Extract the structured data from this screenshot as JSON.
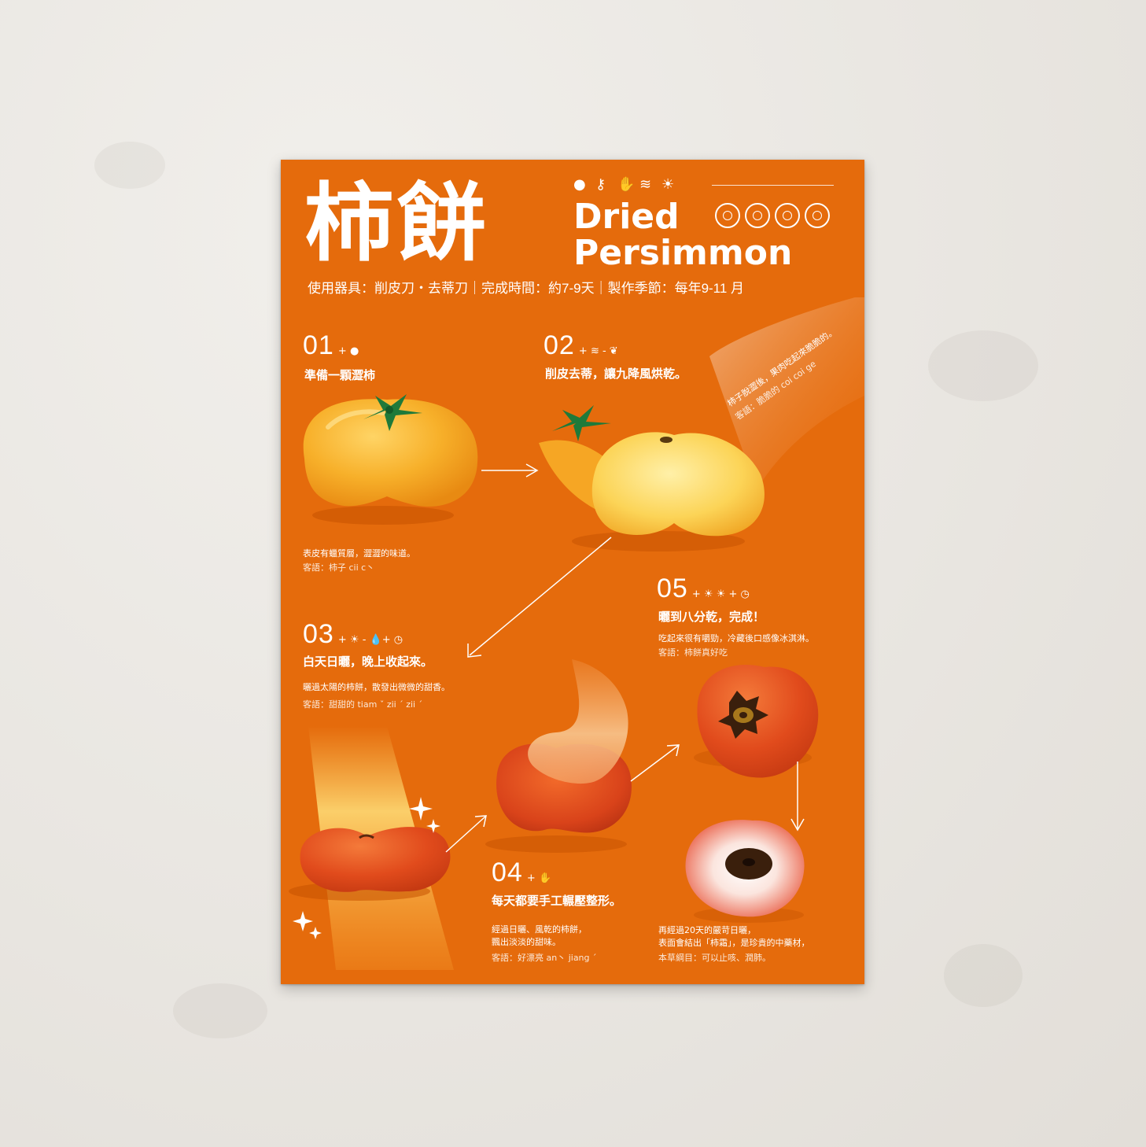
{
  "poster": {
    "title_zh": "柿餅",
    "title_en_line1": "Dried",
    "title_en_line2": "Persimmon",
    "meta": "使用器具：削皮刀・去蒂刀｜完成時間：約7-9天｜製作季節：每年9-11 月",
    "header_icons": [
      "persimmon-icon",
      "knife-icon",
      "hand-icon",
      "wind-icon",
      "sun-icon"
    ]
  },
  "steps": [
    {
      "num": "01",
      "icons": "+ ●",
      "title": "準備一顆澀柿",
      "desc": "表皮有蠟質層，澀澀的味道。",
      "note": "客語：柿子 cii c丶"
    },
    {
      "num": "02",
      "icons": "+ ≋ - ❦",
      "title": "削皮去蒂，讓九降風烘乾。",
      "desc": "柿子脫澀後，果肉吃起來脆脆的。",
      "note": "客語：脆脆的 coi coi ge"
    },
    {
      "num": "03",
      "icons": "+ ☀ - 💧+ ◷",
      "title": "白天日曬，晚上收起來。",
      "desc": "曬過太陽的柿餅，散發出微微的甜香。",
      "note": "客語：甜甜的  tiam ˇ  zii ˊ  zii ˊ"
    },
    {
      "num": "04",
      "icons": "+ ✋",
      "title": "每天都要手工輾壓整形。",
      "desc": "經過日曬、風乾的柿餅，",
      "desc2": "飄出淡淡的甜味。",
      "note": "客語：好漂亮  an丶  jiang ˊ"
    },
    {
      "num": "05",
      "icons": "+ ☀ ☀ + ◷",
      "title": "曬到八分乾，完成！",
      "desc": "吃起來很有嚼勁，冷藏後口感像冰淇淋。",
      "note": "客語：柿餅真好吃"
    }
  ],
  "final_text": {
    "line1": "再經過20天的嚴苛日曬，",
    "line2": "表面會結出「柿霜」，是珍貴的中藥材，",
    "line3": "本草綱目：可以止咳、潤肺。"
  },
  "colors": {
    "poster_bg": "#e56b0c",
    "persimmon_yellow": "#f7b52a",
    "persimmon_red": "#e0461c",
    "leaf_green": "#1f7a3a"
  }
}
